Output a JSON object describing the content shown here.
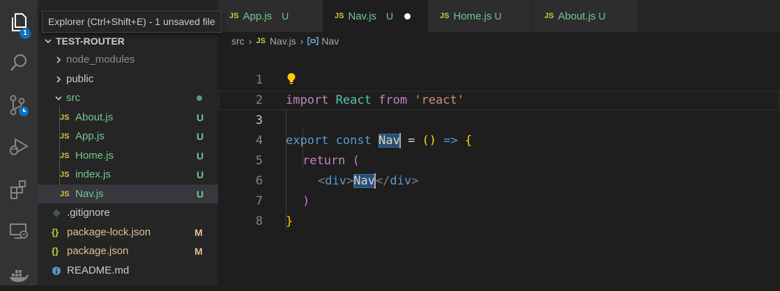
{
  "activity": {
    "explorer_badge": "1"
  },
  "tooltip": "Explorer (Ctrl+Shift+E) - 1 unsaved file",
  "sidebar": {
    "project_title": "TEST-ROUTER",
    "items": [
      {
        "label": "node_modules",
        "kind": "folder"
      },
      {
        "label": "public",
        "kind": "folder"
      },
      {
        "label": "src",
        "kind": "folder-open"
      },
      {
        "label": "About.js",
        "badge": "U",
        "icon": "JS"
      },
      {
        "label": "App.js",
        "badge": "U",
        "icon": "JS"
      },
      {
        "label": "Home.js",
        "badge": "U",
        "icon": "JS"
      },
      {
        "label": "index.js",
        "badge": "U",
        "icon": "JS"
      },
      {
        "label": "Nav.js",
        "badge": "U",
        "icon": "JS"
      },
      {
        "label": ".gitignore"
      },
      {
        "label": "package-lock.json",
        "badge": "M",
        "icon": "{}"
      },
      {
        "label": "package.json",
        "badge": "M",
        "icon": "{}"
      },
      {
        "label": "README.md"
      }
    ]
  },
  "tabs": [
    {
      "icon": "JS",
      "label": "App.js",
      "status": "U"
    },
    {
      "icon": "JS",
      "label": "Nav.js",
      "status": "U"
    },
    {
      "icon": "JS",
      "label": "Home.js",
      "status": "U"
    },
    {
      "icon": "JS",
      "label": "About.js",
      "status": "U"
    }
  ],
  "breadcrumb": {
    "folder": "src",
    "file_icon": "JS",
    "file": "Nav.js",
    "symbol": "Nav"
  },
  "editor": {
    "line_numbers": [
      "1",
      "2",
      "3",
      "4",
      "5",
      "6",
      "7",
      "8"
    ],
    "tokens": {
      "import": "import",
      "react_cls": "React",
      "from": "from",
      "react_str": "'react'",
      "export": "export",
      "const": "const",
      "nav": "Nav",
      "eq": " = ",
      "paren_open": "(",
      "paren_close": ")",
      "arrow": " => ",
      "brace_open": "{",
      "brace_close": "}",
      "return": "return",
      "lt": "<",
      "div": "div",
      "gt": ">",
      "lt_slash": "</"
    }
  },
  "colors": {
    "activity_bg": "#333333",
    "sidebar_bg": "#252526",
    "editor_bg": "#1e1e1e",
    "git_untracked": "#73c991",
    "git_modified": "#e2c08d",
    "js_icon": "#cbcb41",
    "badge_blue": "#0e70c0"
  }
}
